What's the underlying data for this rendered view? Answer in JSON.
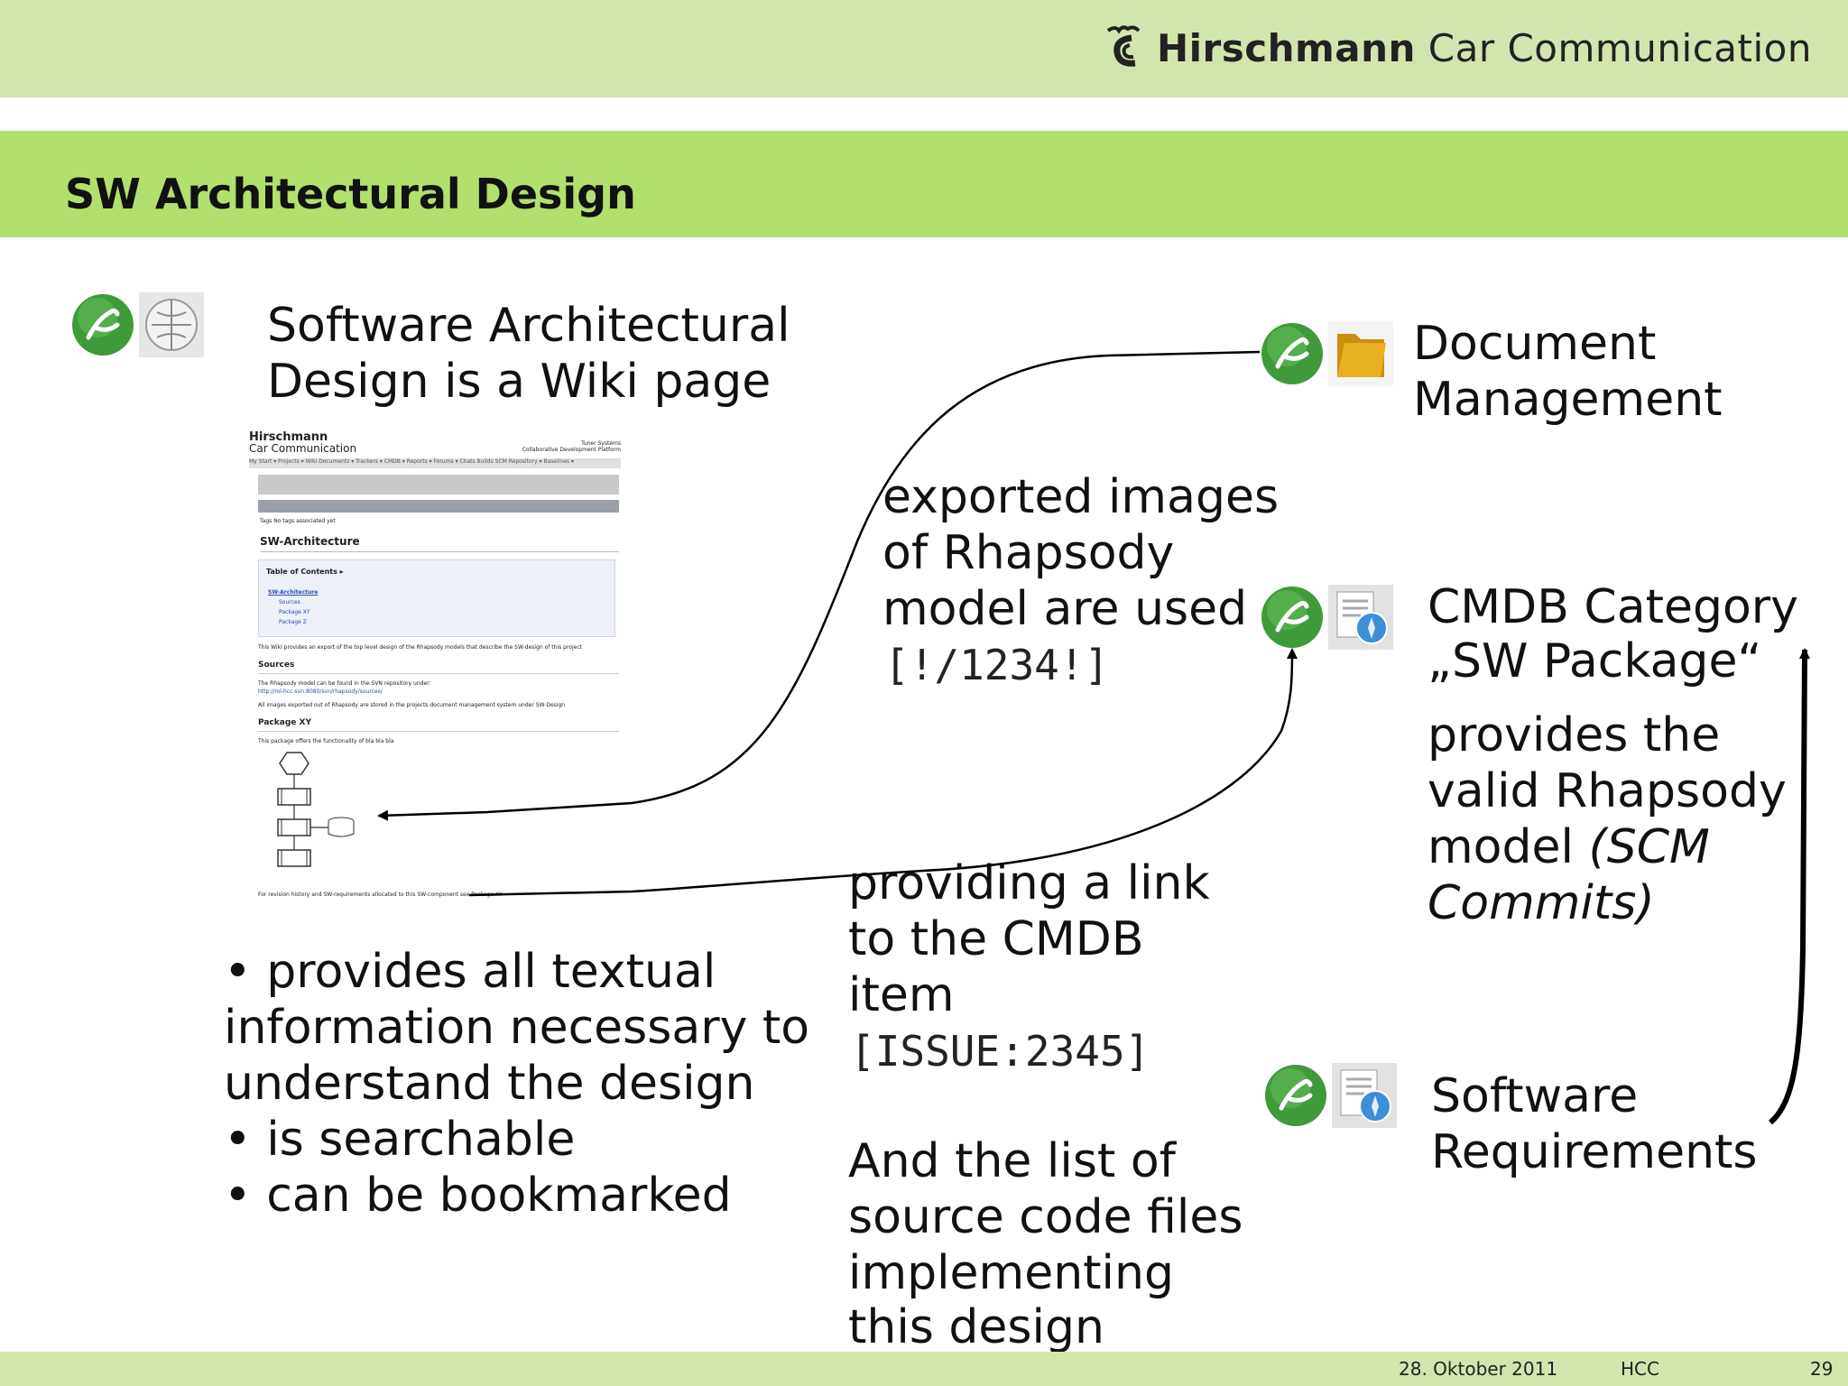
{
  "header": {
    "brand_bold": "Hirschmann",
    "brand_rest": "Car Communication"
  },
  "slide": {
    "title": "SW Architectural Design"
  },
  "left": {
    "heading_line1": "Software Architectural",
    "heading_line2": "Design is a Wiki page",
    "bullets": [
      "• provides all textual",
      "information necessary to",
      "understand the design",
      "• is searchable",
      "• can be bookmarked"
    ]
  },
  "wiki_screenshot": {
    "brand_bold": "Hirschmann",
    "brand_rest": "Car Communication",
    "platform_line1": "Tuner Systems",
    "platform_line2": "Collaborative Development Platform",
    "nav": "My Start ▾   Projects ▾   Wiki   Documents ▾   Trackers ▾   CMDB ▾   Reports ▾   Forums ▾   Chats   Builds   SCM Repository ▾   Baselines ▾",
    "tags": "Tags   No tags associated yet",
    "page_title": "SW-Architecture",
    "toc_title": "Table of Contents ▸",
    "toc_items": [
      "SW-Architecture",
      "Sources",
      "Package XY",
      "Package Z"
    ],
    "intro": "This Wiki provides an export of the top level design of the Rhapsody models that describe the SW-design of this project",
    "sources_heading": "Sources",
    "sources_text": "The Rhapsody model can be found in the SVN repository under:",
    "sources_url": "http://ml-hcc-svn:8080/svn/rhapsody/sources/",
    "images_text": "All images exported out of Rhapsody are stored in the projects document management system under SW-Design",
    "package_heading": "Package XY",
    "package_text": "This package offers the functionality of bla bla bla",
    "footer_note": "For revision history and SW-requirements allocated to this SW-component see Package XY"
  },
  "middle": {
    "exported_lines": [
      "exported images",
      "of Rhapsody",
      "model are used"
    ],
    "exported_code": "[!/1234!]",
    "link_lines": [
      "providing a link",
      "to the CMDB",
      "item"
    ],
    "link_code": "[ISSUE:2345]",
    "list_lines": [
      "And the list of",
      "source code files",
      "implementing",
      "this design"
    ]
  },
  "right": {
    "doc_mgmt_lines": [
      "Document",
      "Management"
    ],
    "cmdb_lines": [
      "CMDB Category",
      "„SW Package“"
    ],
    "provides_lines": [
      "provides the",
      "valid Rhapsody",
      "model "
    ],
    "provides_italic_1": "(SCM",
    "provides_italic_2": "Commits)",
    "sw_req_lines": [
      "Software",
      "Requirements"
    ]
  },
  "footer": {
    "date": "28. Oktober 2011",
    "org": "HCC",
    "page": "29"
  },
  "icons": [
    "hcc-gecko-icon",
    "wikipedia-globe-icon",
    "folder-icon",
    "web-document-icon"
  ],
  "colors": {
    "top_band": "#d3e5ae",
    "title_band": "#b2df6e",
    "icon_green": "#3f9a3a",
    "folder_yellow": "#e6b020",
    "globe_blue": "#3d8fd8"
  }
}
